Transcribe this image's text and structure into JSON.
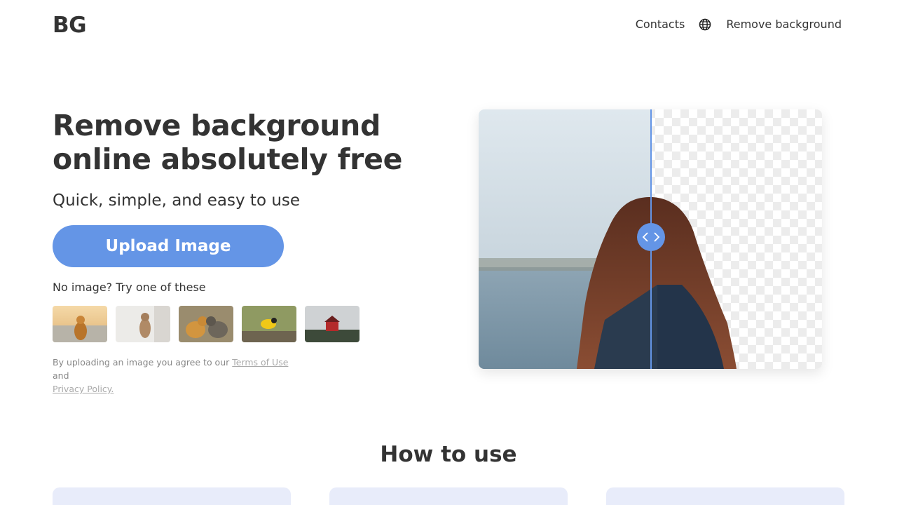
{
  "header": {
    "logo": "BG",
    "nav": {
      "contacts": "Contacts",
      "language_icon": "globe-icon",
      "remove_background": "Remove background"
    }
  },
  "hero": {
    "title": "Remove background online absolutely free",
    "subtitle": "Quick, simple, and easy to use",
    "upload_label": "Upload Image",
    "try_label": "No image? Try one of these",
    "samples": [
      "dog on beach",
      "cat standing",
      "two cats",
      "yellow bird",
      "red house"
    ],
    "terms": {
      "prefix": "By uploading an image you agree to our ",
      "terms_link": "Terms of Use",
      "middle": " and",
      "privacy_link": "Privacy Policy."
    }
  },
  "preview": {
    "handle_icon": "chevrons-left-right-icon"
  },
  "section": {
    "how_title": "How to use"
  },
  "colors": {
    "accent": "#6495e6",
    "card": "#e8ecfa",
    "text": "#333333"
  }
}
